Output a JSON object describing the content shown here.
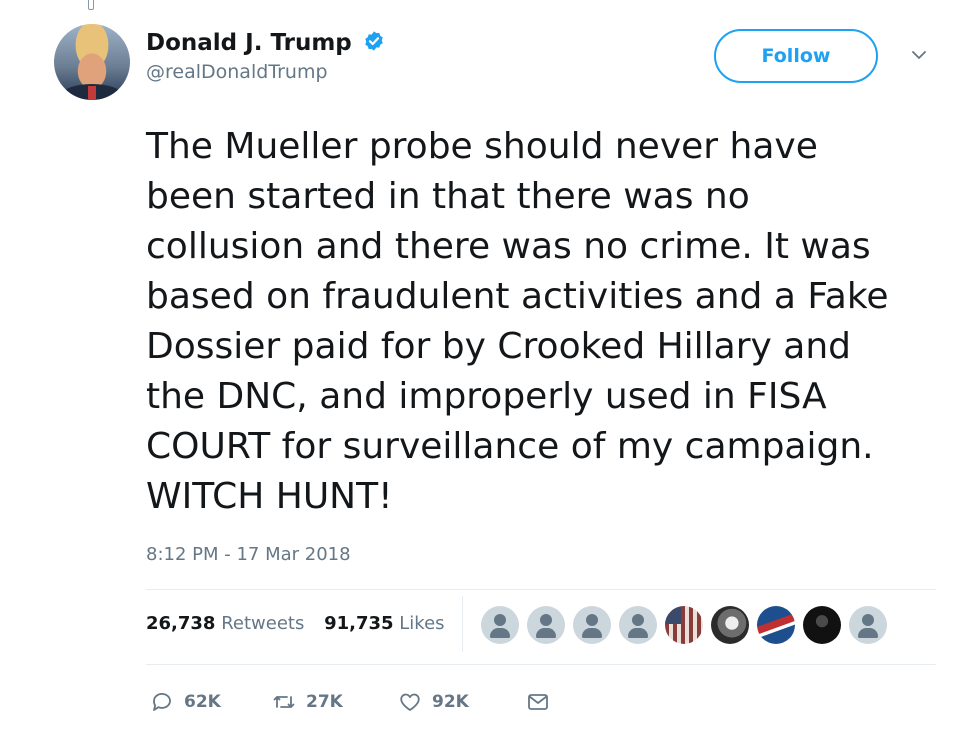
{
  "author": {
    "display_name": "Donald J. Trump",
    "handle": "@realDonaldTrump",
    "verified_icon": "verified-badge-icon",
    "verified_color": "#1da1f2"
  },
  "header": {
    "follow_label": "Follow",
    "menu_icon": "chevron-down-icon"
  },
  "tweet": {
    "text": "The Mueller probe should never have\nbeen started in that there was no\ncollusion and there was no crime. It was\nbased on fraudulent activities and a Fake\nDossier paid for by Crooked Hillary and\nthe DNC, and improperly used in FISA\nCOURT for surveillance of my campaign.\nWITCH HUNT!",
    "timestamp": "8:12 PM - 17 Mar 2018"
  },
  "stats": {
    "retweets_count": "26,738",
    "retweets_label": "Retweets",
    "likes_count": "91,735",
    "likes_label": "Likes",
    "likers": [
      "default",
      "default",
      "default",
      "default",
      "flag",
      "bw-photo",
      "flag-blue",
      "dark-photo",
      "default"
    ]
  },
  "actions": {
    "replies": "62K",
    "retweets": "27K",
    "likes": "92K",
    "reply_icon": "reply-icon",
    "retweet_icon": "retweet-icon",
    "like_icon": "heart-icon",
    "message_icon": "envelope-icon"
  },
  "colors": {
    "accent": "#1da1f2",
    "text": "#14171a",
    "secondary": "#657786",
    "divider": "#e6ecf0"
  }
}
